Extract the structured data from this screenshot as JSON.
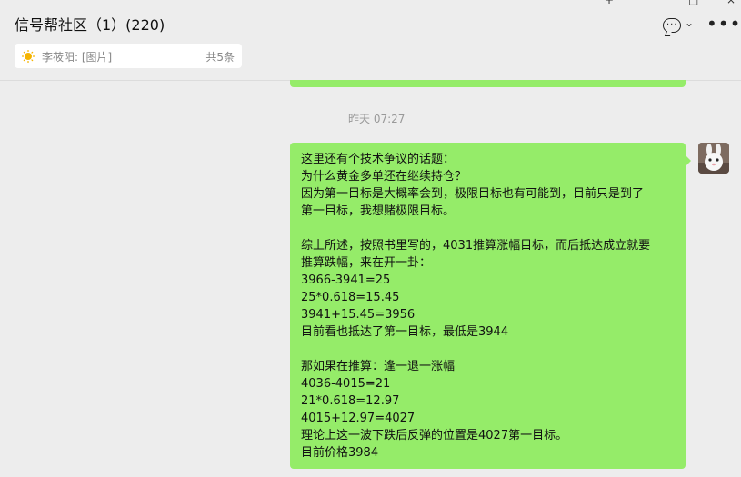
{
  "window": {
    "add_symbol": "+",
    "maximize_symbol": "□",
    "close_symbol": "×"
  },
  "header": {
    "title": "信号帮社区（1）(220)",
    "chevron": "⌄",
    "more": "•••"
  },
  "pinned": {
    "text": "李莜阳: [图片]",
    "count": "共5条"
  },
  "timestamp": "昨天 07:27",
  "message": {
    "lines": [
      "这里还有个技术争议的话题：",
      "为什么黄金多单还在继续持仓？",
      "因为第一目标是大概率会到，极限目标也有可能到，目前只是到了",
      "第一目标，我想赌极限目标。",
      "",
      "综上所述，按照书里写的，4031推算涨幅目标，而后抵达成立就要",
      "推算跌幅，来在开一卦：",
      "3966-3941=25",
      "25*0.618=15.45",
      "3941+15.45=3956",
      "目前看也抵达了第一目标，最低是3944",
      "",
      "那如果在推算：逢一退一涨幅",
      "4036-4015=21",
      "21*0.618=12.97",
      "4015+12.97=4027",
      "理论上这一波下跌后反弹的位置是4027第一目标。",
      "目前价格3984"
    ]
  },
  "colors": {
    "bubble": "#95ec69",
    "background": "#ededed"
  }
}
